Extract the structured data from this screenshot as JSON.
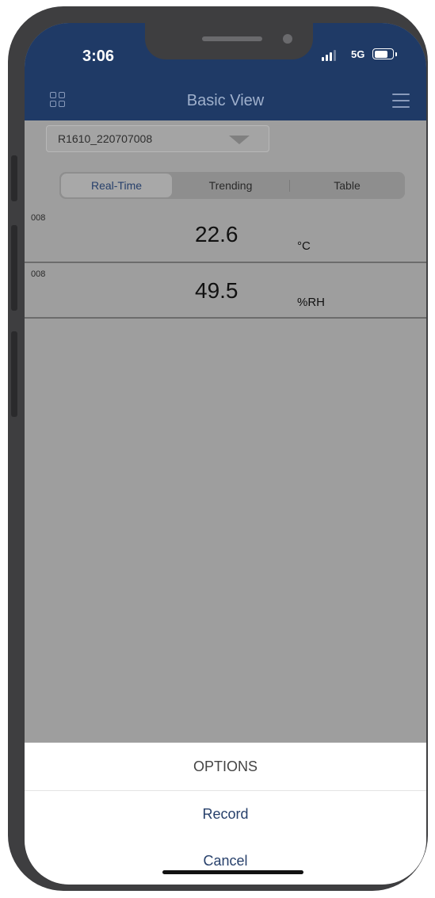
{
  "status_bar": {
    "time": "3:06",
    "network": "5G",
    "signal_bars": 3,
    "battery_level": 0.75
  },
  "nav": {
    "title": "Basic View",
    "left_icon": "grid-icon",
    "right_icon": "hamburger-menu-icon"
  },
  "device_select": {
    "value": "R1610_220707008",
    "icon": "chevron-down-icon"
  },
  "tabs": [
    {
      "label": "Real-Time",
      "active": true
    },
    {
      "label": "Trending",
      "active": false
    },
    {
      "label": "Table",
      "active": false
    }
  ],
  "readings": [
    {
      "id": "008",
      "value": "22.6",
      "unit": "°C"
    },
    {
      "id": "008",
      "value": "49.5",
      "unit": "%RH"
    }
  ],
  "action_sheet": {
    "title": "OPTIONS",
    "options": [
      "Record",
      "Cancel"
    ]
  },
  "colors": {
    "header": "#1f3a66",
    "overlay": "#9e9e9e",
    "accent": "#27406b",
    "sheet": "#ffffff"
  }
}
